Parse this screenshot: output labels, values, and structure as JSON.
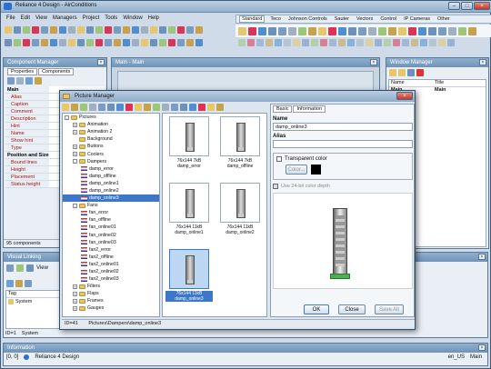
{
  "app": {
    "title": "Reliance 4 Design - AirConditions"
  },
  "menu": [
    "File",
    "Edit",
    "View",
    "Managers",
    "Project",
    "Tools",
    "Window",
    "Help"
  ],
  "palette": {
    "tabs": [
      "Standard",
      "Teco",
      "Johnson Controls",
      "Sauter",
      "Vectors",
      "Control",
      "IP Cameras",
      "Other"
    ],
    "active": "Standard"
  },
  "component_manager": {
    "title": "Component Manager",
    "tabs": [
      "Properties",
      "Components"
    ],
    "rows": [
      {
        "k": "Main",
        "section": true
      },
      {
        "k": "Alias"
      },
      {
        "k": "Caption"
      },
      {
        "k": "Comment"
      },
      {
        "k": "Description"
      },
      {
        "k": "Hint"
      },
      {
        "k": "Name"
      },
      {
        "k": "Show hint"
      },
      {
        "k": "Type"
      },
      {
        "k": "Position and Size",
        "section": true
      },
      {
        "k": "Bound lines"
      },
      {
        "k": "Height"
      },
      {
        "k": "Placement"
      },
      {
        "k": "Status height"
      }
    ],
    "footer": "95 components"
  },
  "main_window": {
    "title": "Main - Main"
  },
  "window_manager": {
    "title": "Window Manager",
    "col_name": "Name",
    "col_title": "Title",
    "row_name": "Main",
    "row_title": "Main"
  },
  "visual_linking": {
    "title": "Visual Linking",
    "view_label": "View",
    "col_tag": "Tag",
    "row": "System",
    "footer_id": "ID=1",
    "footer_val": "System"
  },
  "information": {
    "title": "Information",
    "pos": "[0, 0]",
    "product": "Reliance 4 Design",
    "lang": "en_US",
    "window": "Main"
  },
  "picture_manager": {
    "title": "Picture Manager",
    "tree": [
      {
        "label": "Pictures",
        "level": 0,
        "type": "folder",
        "pm": "-"
      },
      {
        "label": "Animation",
        "level": 1,
        "type": "folder",
        "pm": "+"
      },
      {
        "label": "Animation 2",
        "level": 1,
        "type": "folder",
        "pm": "+"
      },
      {
        "label": "Background",
        "level": 1,
        "type": "folder",
        "pm": ""
      },
      {
        "label": "Buttons",
        "level": 1,
        "type": "folder",
        "pm": "+"
      },
      {
        "label": "Coolers",
        "level": 1,
        "type": "folder",
        "pm": "+"
      },
      {
        "label": "Dampers",
        "level": 1,
        "type": "folder",
        "pm": "-"
      },
      {
        "label": "damp_error",
        "level": 2,
        "type": "flag"
      },
      {
        "label": "damp_offline",
        "level": 2,
        "type": "flag"
      },
      {
        "label": "damp_online1",
        "level": 2,
        "type": "flag"
      },
      {
        "label": "damp_online2",
        "level": 2,
        "type": "flag"
      },
      {
        "label": "damp_online3",
        "level": 2,
        "type": "flag",
        "selected": true
      },
      {
        "label": "Fans",
        "level": 1,
        "type": "folder",
        "pm": "-"
      },
      {
        "label": "fan_error",
        "level": 2,
        "type": "flag"
      },
      {
        "label": "fan_offline",
        "level": 2,
        "type": "flag"
      },
      {
        "label": "fan_online01",
        "level": 2,
        "type": "flag"
      },
      {
        "label": "fan_online02",
        "level": 2,
        "type": "flag"
      },
      {
        "label": "fan_online03",
        "level": 2,
        "type": "flag"
      },
      {
        "label": "fan2_error",
        "level": 2,
        "type": "flag"
      },
      {
        "label": "fan2_offline",
        "level": 2,
        "type": "flag"
      },
      {
        "label": "fan2_online01",
        "level": 2,
        "type": "flag"
      },
      {
        "label": "fan2_online02",
        "level": 2,
        "type": "flag"
      },
      {
        "label": "fan2_online03",
        "level": 2,
        "type": "flag"
      },
      {
        "label": "Filters",
        "level": 1,
        "type": "folder",
        "pm": "+"
      },
      {
        "label": "Flaps",
        "level": 1,
        "type": "folder",
        "pm": "+"
      },
      {
        "label": "Frames",
        "level": 1,
        "type": "folder",
        "pm": "+"
      },
      {
        "label": "Gauges",
        "level": 1,
        "type": "folder",
        "pm": "+"
      }
    ],
    "thumbs": [
      {
        "size": "76x144 7kB",
        "name": "damp_error"
      },
      {
        "size": "76x144 7kB",
        "name": "damp_offline"
      },
      {
        "size": "76x144 11kB",
        "name": "damp_online1"
      },
      {
        "size": "76x144 11kB",
        "name": "damp_online2"
      },
      {
        "size": "76x144 11kB",
        "name": "damp_online3",
        "selected": true
      }
    ],
    "props": {
      "tabs": [
        "Basic",
        "Information"
      ],
      "name_label": "Name",
      "name_value": "damp_online3",
      "alias_label": "Alias",
      "alias_value": "",
      "transparent_label": "Transparent color",
      "color_btn": "Color...",
      "depth_label": "Use 24-bit color depth"
    },
    "buttons": {
      "ok": "OK",
      "close": "Close",
      "save_all": "Save All"
    },
    "status": {
      "id": "ID=41",
      "path": "Pictures\\Dampers\\damp_online3"
    }
  }
}
